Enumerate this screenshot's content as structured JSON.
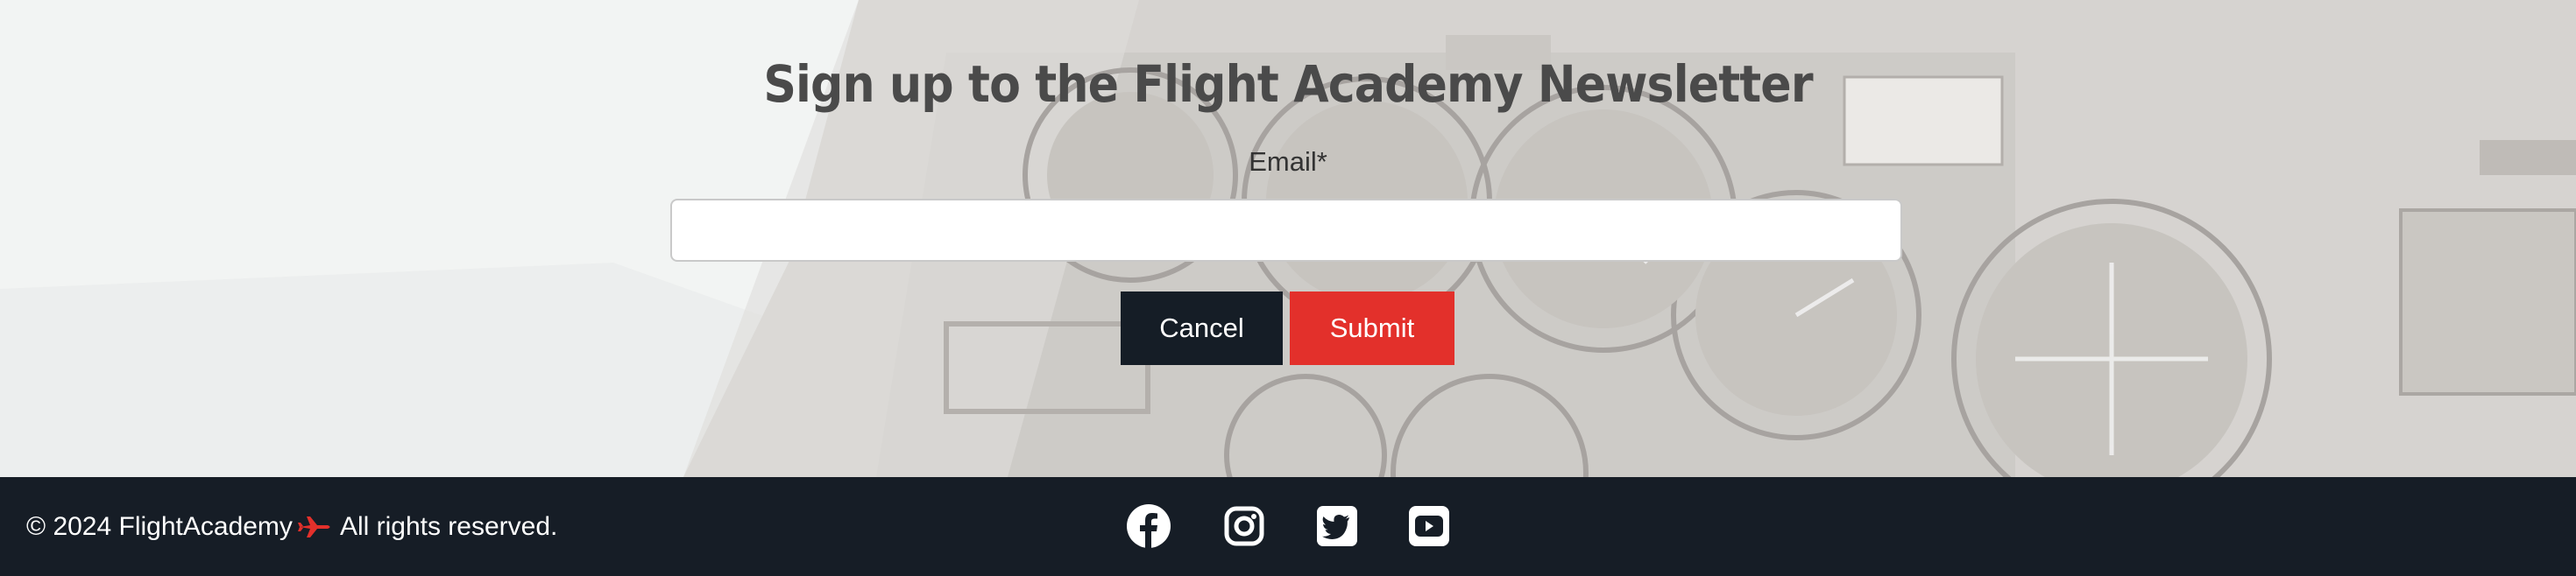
{
  "newsletter": {
    "title": "Sign up to the Flight Academy Newsletter",
    "email_label": "Email*",
    "email_value": "",
    "cancel_label": "Cancel",
    "submit_label": "Submit"
  },
  "footer": {
    "copyright_prefix": "© 2024 FlightAcademy",
    "copyright_suffix": "All rights reserved.",
    "brand_icon": "airplane-icon",
    "social_links": [
      {
        "name": "facebook",
        "icon": "facebook-icon"
      },
      {
        "name": "instagram",
        "icon": "instagram-icon"
      },
      {
        "name": "twitter",
        "icon": "twitter-icon"
      },
      {
        "name": "youtube",
        "icon": "youtube-icon"
      }
    ]
  },
  "colors": {
    "accent": "#e3302b",
    "dark": "#161d26",
    "cancel_bg": "#151d26",
    "title_text": "#4a4a4a"
  }
}
